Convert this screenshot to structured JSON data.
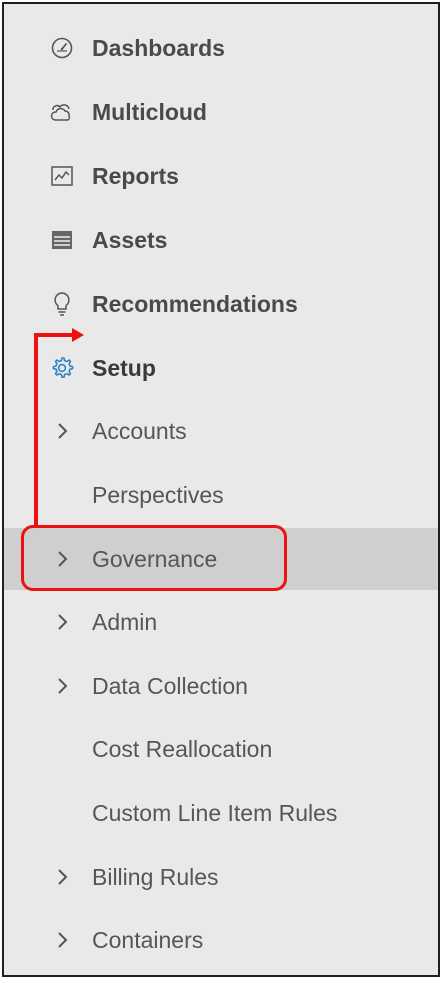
{
  "nav": {
    "items": [
      {
        "label": "Dashboards",
        "icon": "speedometer-icon"
      },
      {
        "label": "Multicloud",
        "icon": "clouds-icon"
      },
      {
        "label": "Reports",
        "icon": "line-chart-icon"
      },
      {
        "label": "Assets",
        "icon": "server-stack-icon"
      },
      {
        "label": "Recommendations",
        "icon": "lightbulb-icon"
      },
      {
        "label": "Setup",
        "icon": "gear-icon"
      }
    ],
    "setup_children": [
      {
        "label": "Accounts",
        "expandable": true
      },
      {
        "label": "Perspectives",
        "expandable": false
      },
      {
        "label": "Governance",
        "expandable": true,
        "selected": true
      },
      {
        "label": "Admin",
        "expandable": true
      },
      {
        "label": "Data Collection",
        "expandable": true
      },
      {
        "label": "Cost Reallocation",
        "expandable": false
      },
      {
        "label": "Custom Line Item Rules",
        "expandable": false
      },
      {
        "label": "Billing Rules",
        "expandable": true
      },
      {
        "label": "Containers",
        "expandable": true
      }
    ]
  },
  "colors": {
    "annotation": "#ee1111",
    "setup_icon": "#2a86c9",
    "selected_row": "#cfcfcf",
    "panel_bg": "#e9e9e9"
  }
}
